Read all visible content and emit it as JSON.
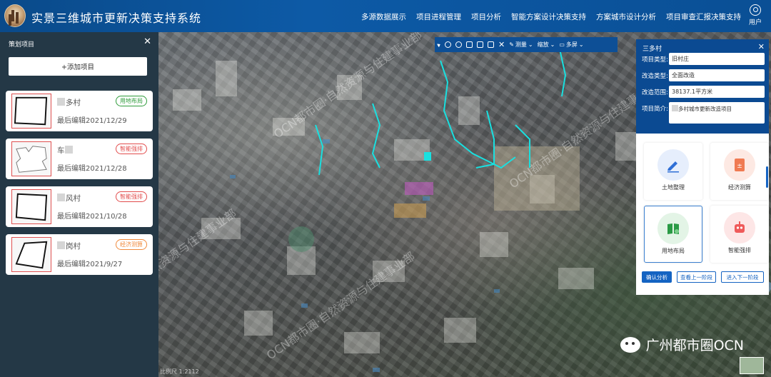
{
  "header": {
    "title": "实景三维城市更新决策支持系统",
    "nav": [
      "多源数据展示",
      "项目进程管理",
      "项目分析",
      "智能方案设计决策支持",
      "方案城市设计分析",
      "项目审查汇报决策支持"
    ],
    "user_label": "用户"
  },
  "left_panel": {
    "title": "策划项目",
    "add_button": "+添加项目",
    "projects": [
      {
        "name": "多村",
        "date": "最后编辑2021/12/29",
        "badge": "用地布局",
        "badge_color": "green"
      },
      {
        "name": "车",
        "date": "最后编辑2021/12/28",
        "badge": "智能强排",
        "badge_color": "red"
      },
      {
        "name": "风村",
        "date": "最后编辑2021/10/28",
        "badge": "智能强排",
        "badge_color": "red"
      },
      {
        "name": "岗村",
        "date": "最后编辑2021/9/27",
        "badge": "经济测算",
        "badge_color": "orange"
      }
    ]
  },
  "toolbar": {
    "measure": "测量",
    "zoom": "缩放",
    "split": "多屏"
  },
  "right_panel": {
    "title": "三多村",
    "fields": [
      {
        "label": "项目类型:",
        "value": "旧村庄"
      },
      {
        "label": "改造类型:",
        "value": "全面改造"
      },
      {
        "label": "改造范围:",
        "value": "38137.1平方米"
      }
    ],
    "intro_label": "项目简介:",
    "intro_value": "多村城市更新改造项目",
    "functions": [
      {
        "label": "土地整理",
        "icon": "pen-icon",
        "active": false
      },
      {
        "label": "经济测算",
        "icon": "calculator-icon",
        "active": false
      },
      {
        "label": "用地布局",
        "icon": "book-icon",
        "active": true
      },
      {
        "label": "智能强排",
        "icon": "robot-icon",
        "active": false
      }
    ],
    "buttons": {
      "confirm": "确认分析",
      "prev": "查看上一阶段",
      "next": "进入下一阶段"
    }
  },
  "map": {
    "watermarks": [
      "OCN都市圈·自然资源与住建事业部",
      "OCN都市圈·自然资源与住建事业部",
      "OCN都市圈·自然资源与住建事业部",
      "OCN都市圈·自然资源与住建事业部"
    ],
    "brand": "广州都市圈OCN",
    "scale_text": "比例尺 1:2112"
  }
}
